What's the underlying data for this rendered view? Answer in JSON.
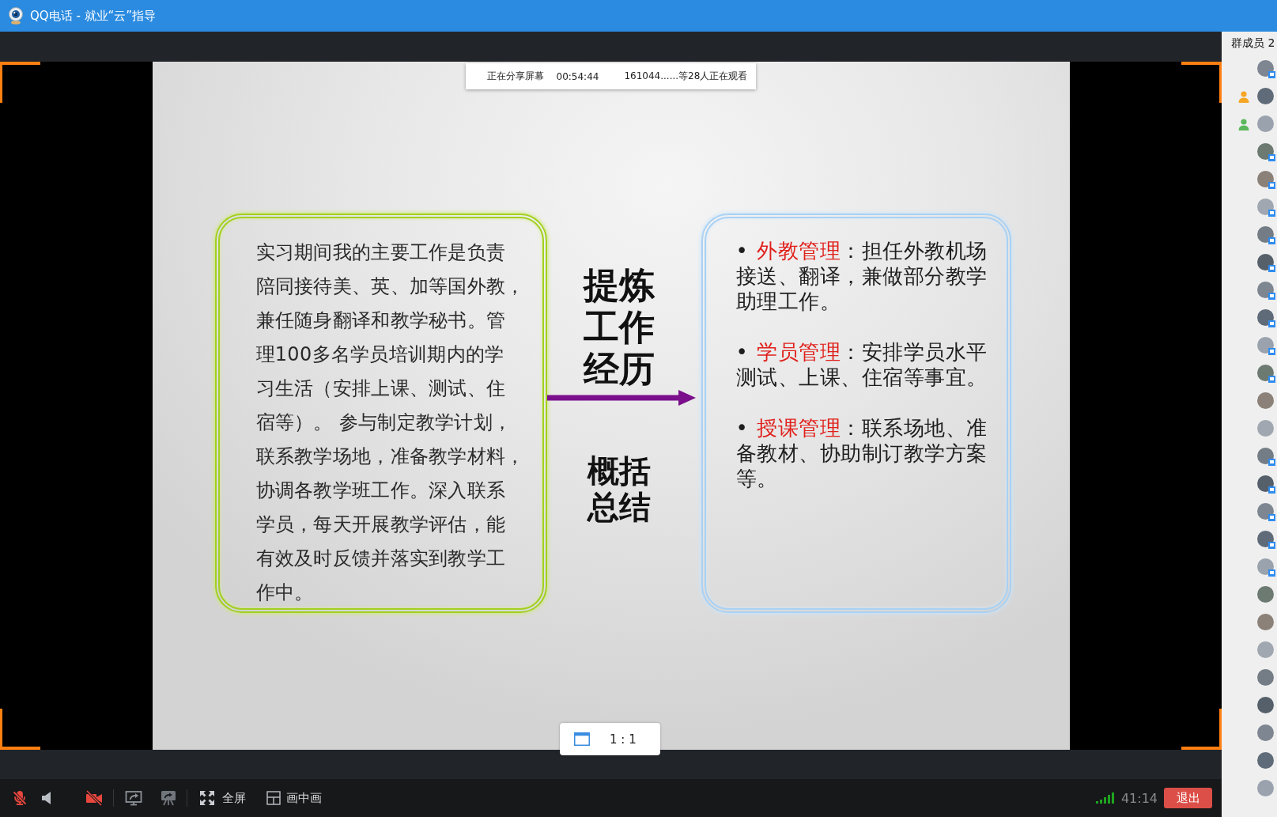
{
  "window": {
    "title": "QQ电话 - 就业“云”指导"
  },
  "members_panel": {
    "title": "群成员 2",
    "members": [
      {
        "badge": true
      },
      {
        "badge": false,
        "color": "#f5a623"
      },
      {
        "badge": false,
        "color": "#5cb85c"
      },
      {
        "badge": true
      },
      {
        "badge": true
      },
      {
        "badge": true
      },
      {
        "badge": true
      },
      {
        "badge": true
      },
      {
        "badge": true
      },
      {
        "badge": true
      },
      {
        "badge": true
      },
      {
        "badge": true
      },
      {
        "badge": false
      },
      {
        "badge": false
      },
      {
        "badge": true
      },
      {
        "badge": true
      },
      {
        "badge": true
      },
      {
        "badge": true
      },
      {
        "badge": true
      },
      {
        "badge": false
      },
      {
        "badge": false
      },
      {
        "badge": false
      },
      {
        "badge": false
      },
      {
        "badge": false
      },
      {
        "badge": false
      },
      {
        "badge": false
      },
      {
        "badge": false
      }
    ]
  },
  "share_status": {
    "status": "正在分享屏幕",
    "duration": "00:54:44",
    "viewers": "161044......等28人正在观看"
  },
  "slide": {
    "left_box": {
      "lines": [
        "实习期间我的主要工作是负责",
        "陪同接待美、英、加等国外教，",
        "兼任随身翻译和教学秘书。管",
        "理100多名学员培训期内的学",
        "习生活（安排上课、测试、住",
        "宿等）。 参与制定教学计划，",
        "联系教学场地，准备教学材料，",
        "协调各教学班工作。深入联系",
        "学员，每天开展教学评估，能",
        "有效及时反馈并落实到教学工",
        "作中。"
      ]
    },
    "center": {
      "top_label": "提炼工作经历",
      "bottom_label": "概括总结"
    },
    "right_box": {
      "items": [
        {
          "bullet": "•",
          "term": "外教管理",
          "detail": "：担任外教机场接送、翻译，兼做部分教学助理工作。"
        },
        {
          "bullet": "•",
          "term": "学员管理",
          "detail": "：安排学员水平测试、上课、住宿等事宜。"
        },
        {
          "bullet": "•",
          "term": "授课管理",
          "detail": "：联系场地、准备教材、协助制订教学方案等。"
        }
      ]
    }
  },
  "view_button": {
    "label": "1 : 1"
  },
  "toolbar": {
    "tools": [
      {
        "kind": "microphone",
        "off": true
      },
      {
        "kind": "speaker",
        "off": false
      },
      {
        "kind": "camera",
        "off": true
      },
      {
        "kind": "divider"
      },
      {
        "kind": "screen_share"
      },
      {
        "kind": "presentation"
      },
      {
        "kind": "divider"
      },
      {
        "kind": "fullscreen",
        "label": "全屏"
      },
      {
        "kind": "picture_in_picture",
        "label": "画中画"
      }
    ],
    "timer": "41:14",
    "exit_button": "退出"
  }
}
